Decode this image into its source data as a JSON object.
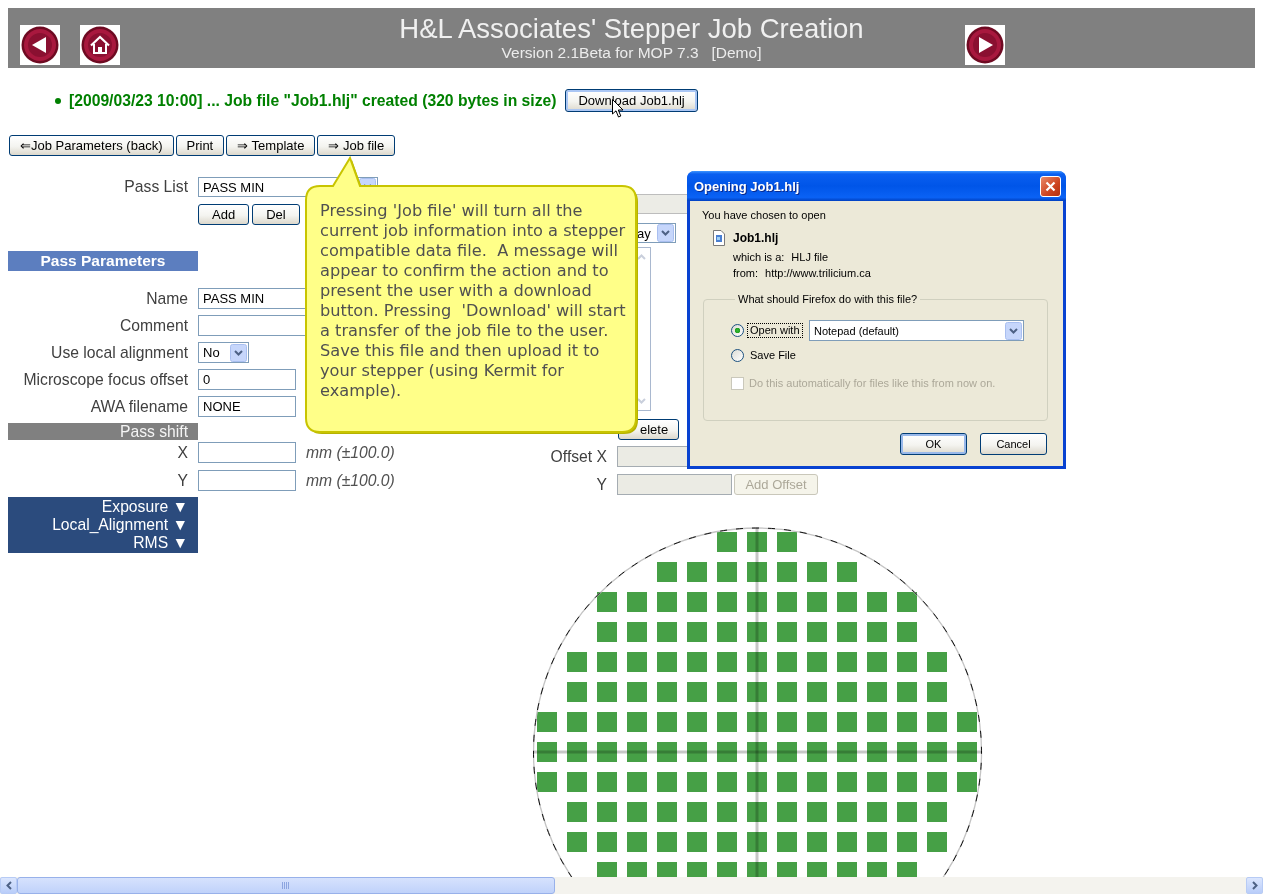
{
  "header": {
    "title": "H&L Associates' Stepper Job Creation",
    "subtitle": "Version 2.1Beta for MOP 7.3   [Demo]"
  },
  "status": {
    "message": "[2009/03/23 10:00] ... Job file \"Job1.hlj\" created (320 bytes in size)",
    "button": "Download Job1.hlj"
  },
  "toolbar": [
    "⇐Job Parameters (back)",
    "Print",
    "⇒ Template",
    "⇒ Job file"
  ],
  "pass_list": {
    "label": "Pass List",
    "value": "PASS MIN",
    "buttons": [
      "Add",
      "Del"
    ]
  },
  "pass_parameters": {
    "title": "Pass Parameters",
    "fields": [
      {
        "kind": "wide",
        "label": "Name",
        "value": "PASS MIN"
      },
      {
        "kind": "wide",
        "label": "Comment"
      },
      {
        "kind": "select",
        "label": "Use local alignment",
        "value": "No"
      },
      {
        "kind": "text",
        "label": "Microscope focus offset",
        "value": "0"
      },
      {
        "kind": "text",
        "label": "AWA filename",
        "value": "NONE"
      }
    ]
  },
  "pass_shift": {
    "title": "Pass shift",
    "fields": [
      {
        "label": "X",
        "unit": "mm (±100.0)"
      },
      {
        "label": "Y",
        "unit": "mm (±100.0)"
      }
    ]
  },
  "sections": [
    "Exposure ▼",
    "Local_Alignment ▼",
    "RMS ▼"
  ],
  "side_panel": {
    "select_value": "ay",
    "button": "elete",
    "offset": {
      "x_label": "Offset X",
      "y_label": "Y",
      "button": "Add Offset",
      "disabled": true
    }
  },
  "tooltip": {
    "text": "Pressing 'Job file' will turn all the current job information into a stepper compatible data file.  A message will appear to confirm the action and to present the user with a download button. Pressing  'Download' will start a transfer of the job file to the user. Save this file and then upload it to your stepper (using Kermit for example)."
  },
  "dialog": {
    "title": "Opening Job1.hlj",
    "intro": "You have chosen to open",
    "file_name": "Job1.hlj",
    "file_info": [
      {
        "label": "which is a:",
        "value": "HLJ file"
      },
      {
        "label": "from:",
        "value": "http://www.trilicium.ca"
      }
    ],
    "question": "What should Firefox do with this file?",
    "options": [
      {
        "label": "Open with",
        "selected": true,
        "focused": true,
        "application": "Notepad (default)"
      },
      {
        "label": "Save File",
        "selected": false,
        "focused": false
      }
    ],
    "remember": {
      "label": "Do this automatically for files like this from now on.",
      "checked": false,
      "disabled": true
    },
    "buttons": [
      {
        "label": "OK",
        "default": true
      },
      {
        "label": "Cancel",
        "default": false
      }
    ]
  }
}
